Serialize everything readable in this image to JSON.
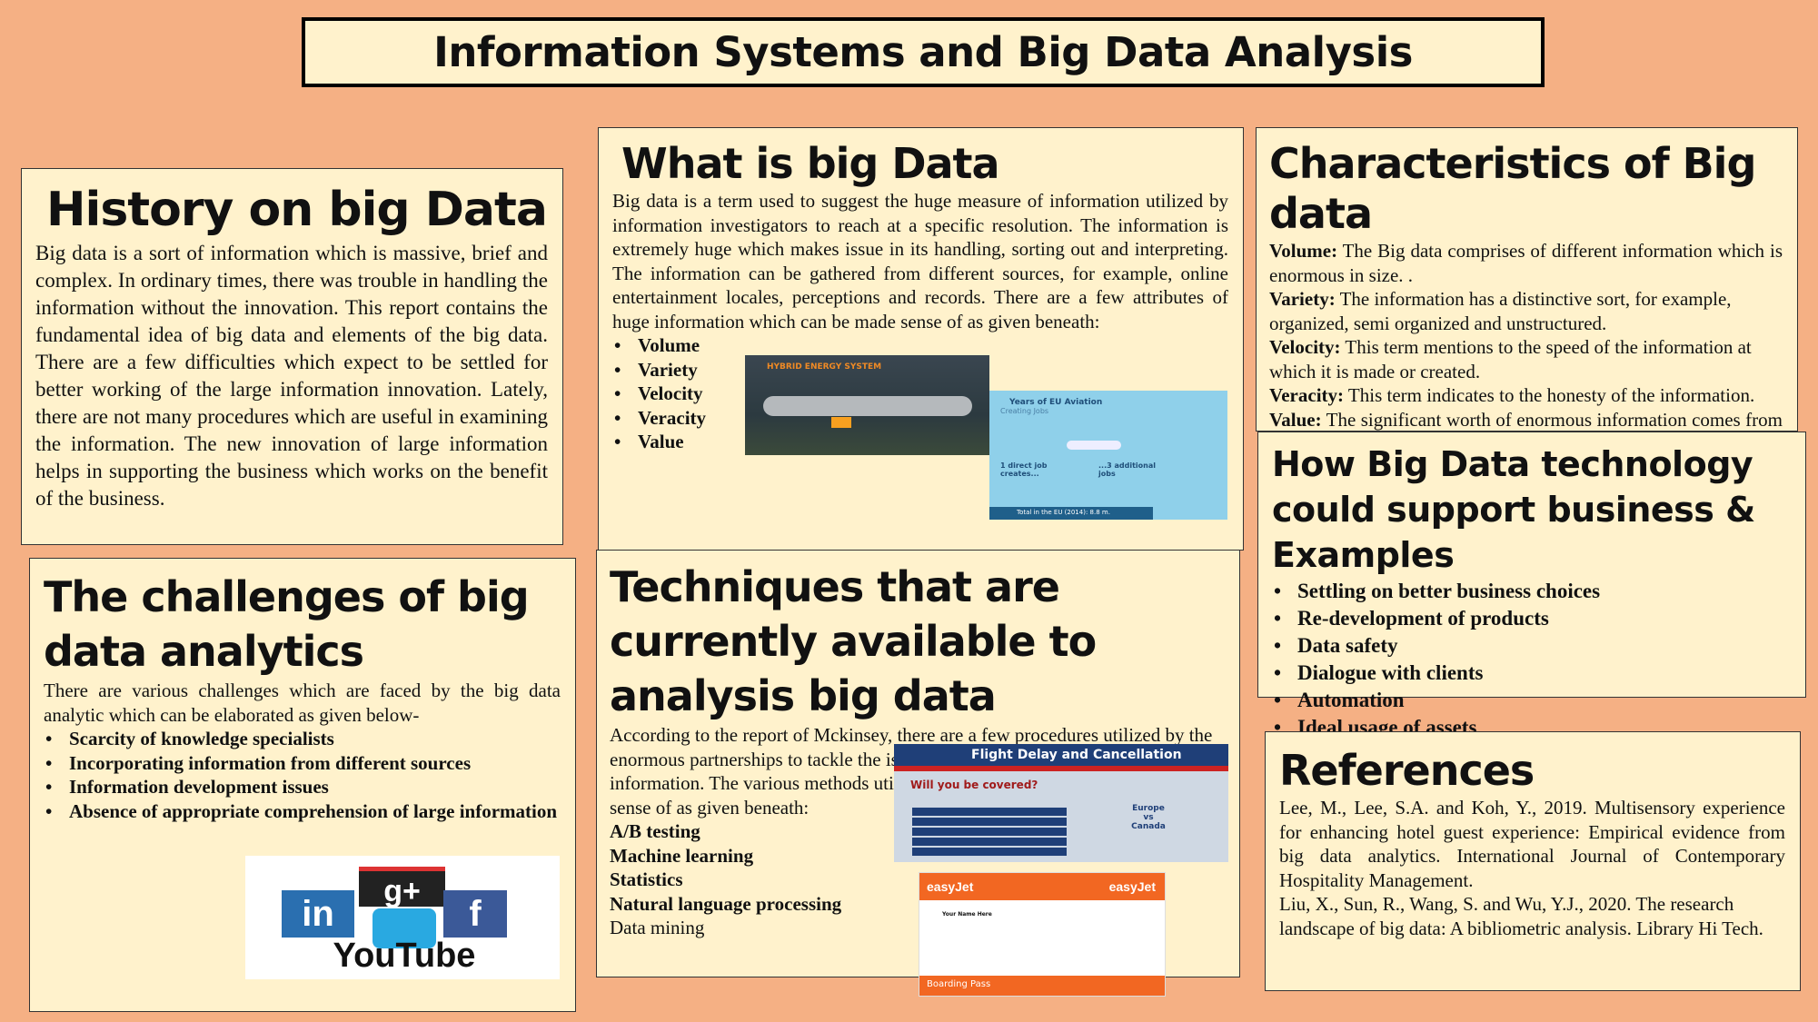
{
  "title": "Information Systems and Big Data Analysis",
  "history": {
    "heading": "History on big Data",
    "body": "Big data is a sort of information which is massive, brief and complex. In ordinary times, there was trouble in handling the information without the innovation. This report contains the fundamental idea of big data and elements of the big data. There are a few difficulties which expect to be settled for better working of the large information innovation. Lately, there are not many procedures which are useful in examining the information. The new innovation of large information helps in supporting the business which works on the benefit of the business."
  },
  "what": {
    "heading": "What is big Data",
    "body": "Big data is a term used to suggest the huge measure of information utilized by information investigators to reach at a specific resolution. The information is extremely huge which makes issue in its handling, sorting out and interpreting. The information can be gathered from different sources, for example, online entertainment locales, perceptions and records. There are a few attributes of huge information which can be made sense of as given beneath:",
    "items": [
      "Volume",
      "Variety",
      "Velocity",
      "Veracity",
      "Value"
    ],
    "image1": {
      "title": "HYBRID ENERGY SYSTEM"
    },
    "image2": {
      "title": "Years of EU Aviation",
      "subtitle": "Creating Jobs",
      "left": "1 direct job creates...",
      "right": "...3 additional jobs",
      "footer": "Total in the EU (2014): 8.8 m."
    }
  },
  "characteristics": {
    "heading": "Characteristics of Big data",
    "items": [
      {
        "term": "Volume:",
        "text": " The Big data comprises of different information which is enormous in size. ."
      },
      {
        "term": "Variety:",
        "text": " The information has a distinctive sort, for example, organized, semi organized and unstructured."
      },
      {
        "term": "Velocity:",
        "text": " This term mentions to the speed of the information at which it is made or created."
      },
      {
        "term": "Veracity:",
        "text": " This term indicates to the honesty of the information."
      },
      {
        "term": "Value:",
        "text": " The significant worth of enormous information comes from the viable activities, solid client connections and a few business benefits in evaluating connections."
      }
    ]
  },
  "how": {
    "heading": "How Big Data technology could support business & Examples",
    "items": [
      "Settling on better business choices",
      "Re-development of products",
      "Data safety",
      "Dialogue with clients",
      "Automation",
      "Ideal usage of assets"
    ]
  },
  "challenges": {
    "heading": "The challenges of big data analytics",
    "body": "There are various challenges which are faced by the big data analytic which can be elaborated as given below-",
    "items": [
      "Scarcity of knowledge specialists",
      "Incorporating information from different sources",
      "Information development issues",
      "Absence of appropriate comprehension of large information"
    ]
  },
  "techniques": {
    "heading": "Techniques that are currently available to analysis big data",
    "body": "According to the report of Mckinsey, there are a few procedures utilized by the enormous partnerships to tackle the issue of the huge and heterogeneous information. The various methods utilized in enormous information are made sense of as given beneath:",
    "bold_items": [
      "A/B testing",
      "Machine learning",
      "Statistics",
      "Natural language processing"
    ],
    "plain_item": "Data mining",
    "image1": {
      "title": "Flight Delay and Cancellation",
      "question": "Will you be covered?",
      "middle": "Europe vs Canada"
    },
    "image2": {
      "brand": "easyJet",
      "label": "Boarding Pass",
      "name": "Your Name Here"
    }
  },
  "references": {
    "heading": "References",
    "items": [
      "Lee, M., Lee, S.A. and Koh, Y., 2019. Multisensory experience for enhancing hotel guest experience: Empirical evidence from big data analytics. International Journal of Contemporary Hospitality Management.",
      "Liu, X., Sun, R., Wang, S. and Wu, Y.J., 2020. The research landscape of big data: A bibliometric analysis. Library Hi Tech."
    ]
  },
  "social": {
    "labels": [
      "in",
      "g+",
      "f",
      "YouTube"
    ]
  }
}
